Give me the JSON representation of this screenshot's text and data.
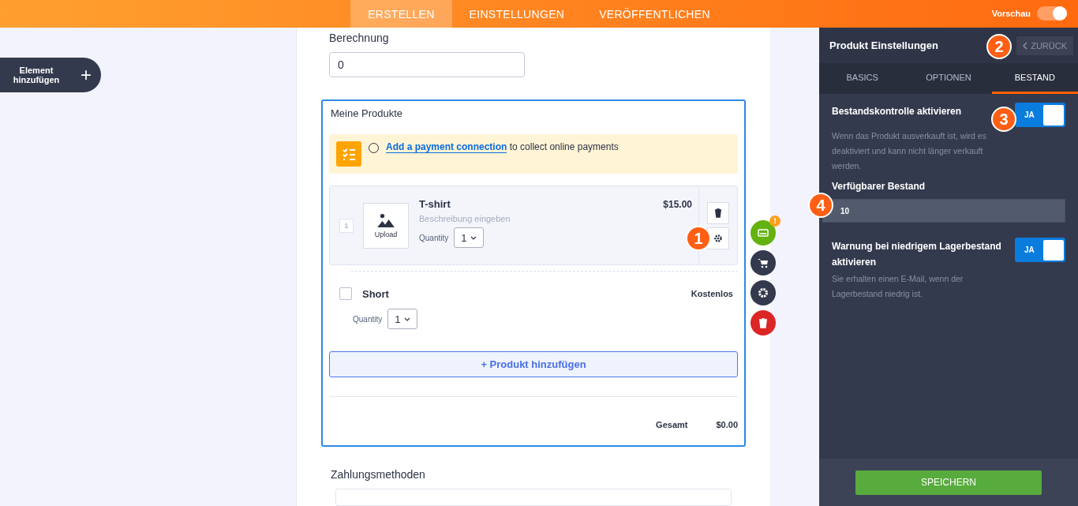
{
  "top_nav": {
    "tabs": [
      {
        "label": "ERSTELLEN",
        "selected": true
      },
      {
        "label": "EINSTELLUNGEN",
        "selected": false
      },
      {
        "label": "VERÖFFENTLICHEN",
        "selected": false
      }
    ],
    "preview": {
      "label": "Vorschau",
      "on": true
    }
  },
  "add_element": {
    "label": "Element hinzufügen",
    "icon": "+"
  },
  "form": {
    "calc": {
      "label": "Berechnung",
      "value": "0"
    },
    "products": {
      "title": "Meine Produkte",
      "notice": {
        "link": "Add a payment connection",
        "text": " to collect online payments"
      },
      "items": [
        {
          "kind": "image",
          "number": "1",
          "upload": "Upload",
          "name": "T-shirt",
          "description": "Beschreibung eingeben",
          "price": "$15.00",
          "quantity_label": "Quantity",
          "quantity": "1"
        },
        {
          "kind": "checkbox",
          "checked": false,
          "name": "Short",
          "price": "Kostenlos",
          "quantity_label": "Quantity",
          "quantity": "1"
        }
      ],
      "add_button": "+ Produkt hinzufügen",
      "total_label": "Gesamt",
      "total": "$0.00"
    },
    "payments_label": "Zahlungsmethoden"
  },
  "tools": [
    {
      "kind": "card",
      "alert": "!"
    },
    {
      "kind": "cart"
    },
    {
      "kind": "gear"
    },
    {
      "kind": "trash"
    }
  ],
  "panel": {
    "title": "Produkt Einstellungen",
    "back": "ZURÜCK",
    "tabs": [
      {
        "label": "BASICS",
        "selected": false
      },
      {
        "label": "OPTIONEN",
        "selected": false
      },
      {
        "label": "BESTAND",
        "selected": true
      }
    ],
    "settings": [
      {
        "kind": "toggle",
        "label": "Bestandskontrolle aktivieren",
        "on": true,
        "toggle_text": "JA",
        "help": "Wenn das Produkt ausverkauft ist, wird es deaktiviert und kann nicht länger verkauft werden."
      },
      {
        "kind": "input",
        "label": "Verfügbarer Bestand",
        "value": "10"
      },
      {
        "kind": "toggle",
        "label": "Warnung bei niedrigem Lagerbestand aktivieren",
        "on": true,
        "toggle_text": "JA",
        "help": "Sie erhalten einen E-Mail, wenn der Lagerbestand niedrig ist."
      }
    ],
    "save": "SPEICHERN"
  },
  "callouts": [
    "1",
    "2",
    "3",
    "4"
  ]
}
